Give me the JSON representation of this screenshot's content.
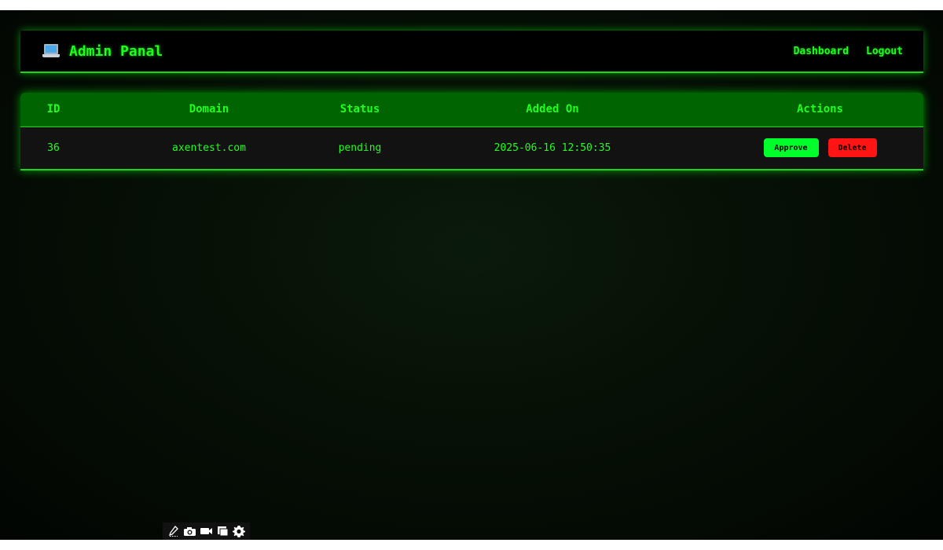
{
  "navbar": {
    "brand_icon": "laptop-icon",
    "title": "Admin Panal",
    "links": [
      {
        "label": "Dashboard"
      },
      {
        "label": "Logout"
      }
    ]
  },
  "table": {
    "headers": [
      "ID",
      "Domain",
      "Status",
      "Added On",
      "Actions"
    ],
    "rows": [
      {
        "id": "36",
        "domain": "axentest.com",
        "status": "pending",
        "added_on": "2025-06-16 12:50:35",
        "approve_label": "Approve",
        "delete_label": "Delete"
      }
    ]
  },
  "toolbar": {
    "icons": [
      "pen-icon",
      "camera-icon",
      "video-icon",
      "window-icon",
      "gear-icon"
    ]
  },
  "colors": {
    "accent": "#1eff1e",
    "header_bg": "#006400",
    "approve": "#00ff2a",
    "delete": "#ff1414"
  }
}
